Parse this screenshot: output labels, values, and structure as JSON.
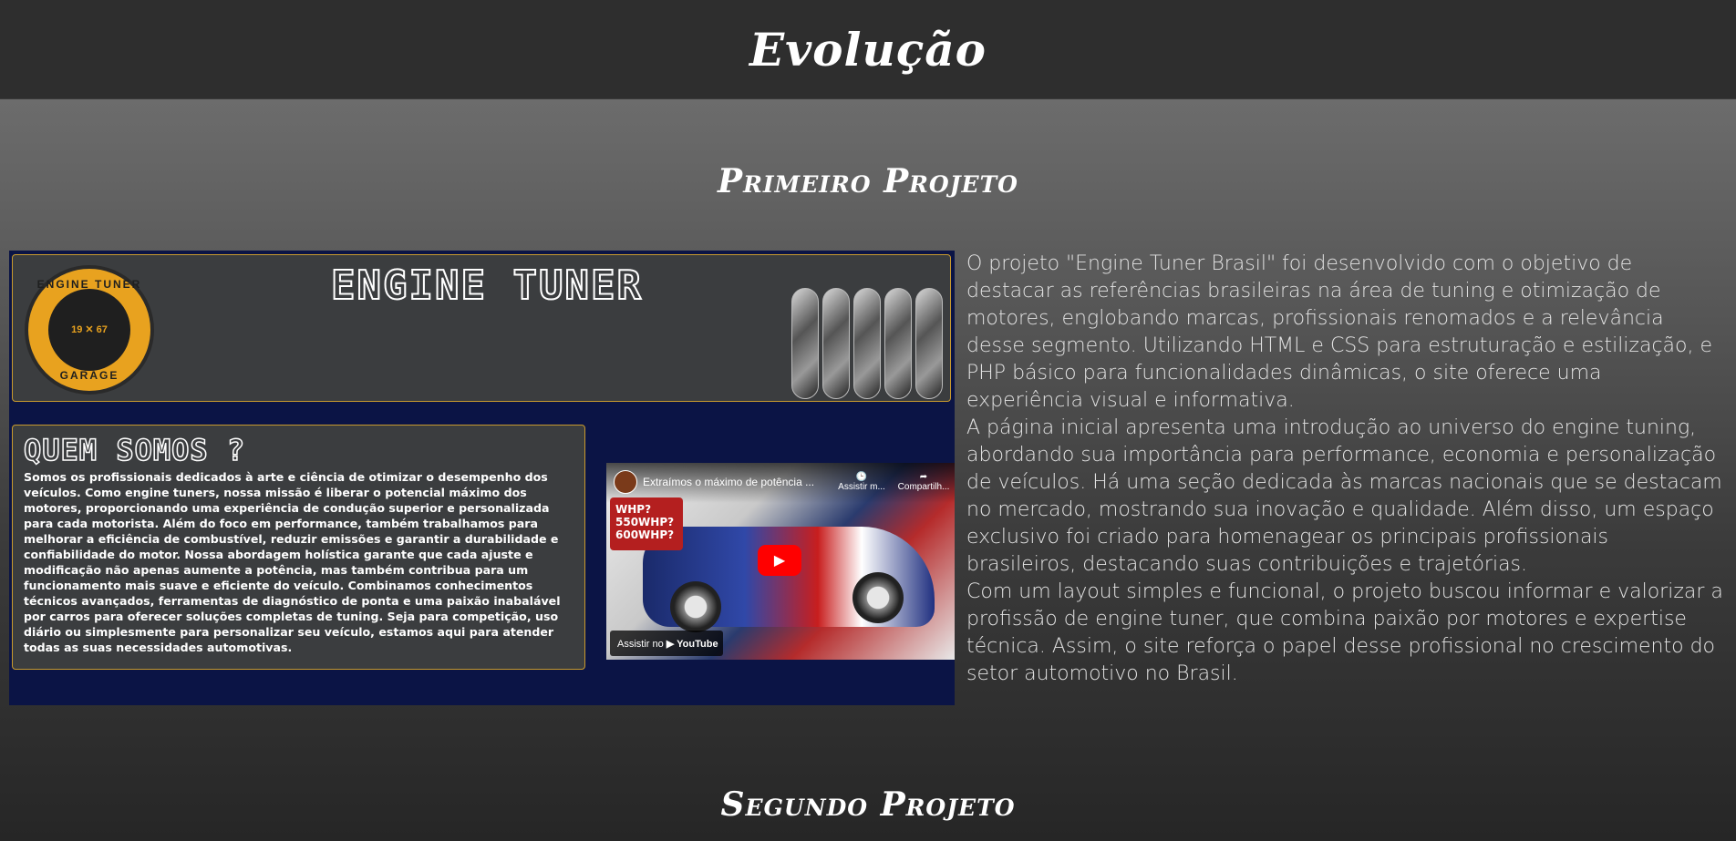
{
  "header": {
    "title": "Evolução"
  },
  "sections": [
    {
      "title": "Primeiro Projeto"
    },
    {
      "title": "Segundo Projeto"
    }
  ],
  "preview": {
    "logo": {
      "top_text": "ENGINE TUNER",
      "year_left": "19",
      "year_right": "67",
      "bottom_text": "GARAGE"
    },
    "site_title": "ENGINE TUNER",
    "about": {
      "heading": "QUEM SOMOS ?",
      "text": "Somos os profissionais dedicados à arte e ciência de otimizar o desempenho dos veículos. Como engine tuners, nossa missão é liberar o potencial máximo dos motores, proporcionando uma experiência de condução superior e personalizada para cada motorista. Além do foco em performance, também trabalhamos para melhorar a eficiência de combustível, reduzir emissões e garantir a durabilidade e confiabilidade do motor. Nossa abordagem holística garante que cada ajuste e modificação não apenas aumente a potência, mas também contribua para um funcionamento mais suave e eficiente do veículo. Combinamos conhecimentos técnicos avançados, ferramentas de diagnóstico de ponta e uma paixão inabalável por carros para oferecer soluções completas de tuning. Seja para competição, uso diário ou simplesmente para personalizar seu veículo, estamos aqui para atender todas as suas necessidades automotivas."
    },
    "video": {
      "title": "Extraímos o máximo de potência ...",
      "watch_later": "Assistir m...",
      "share": "Compartilh...",
      "badge": "WHP?\n550WHP?\n600WHP?",
      "watch_on": "Assistir no",
      "brand": "YouTube"
    }
  },
  "description": [
    "O projeto \"Engine Tuner Brasil\" foi desenvolvido com o objetivo de destacar as referências brasileiras na área de tuning e otimização de motores, englobando marcas, profissionais renomados e a relevância desse segmento. Utilizando HTML e CSS para estruturação e estilização, e PHP básico para funcionalidades dinâmicas, o site oferece uma experiência visual e informativa.",
    "A página inicial apresenta uma introdução ao universo do engine tuning, abordando sua importância para performance, economia e personalização de veículos. Há uma seção dedicada às marcas nacionais que se destacam no mercado, mostrando sua inovação e qualidade. Além disso, um espaço exclusivo foi criado para homenagear os principais profissionais brasileiros, destacando suas contribuições e trajetórias.",
    "Com um layout simples e funcional, o projeto buscou informar e valorizar a profissão de engine tuner, que combina paixão por motores e expertise técnica. Assim, o site reforça o papel desse profissional no crescimento do setor automotivo no Brasil."
  ],
  "colors": {
    "accent_gold": "#c89a2d",
    "preview_bg": "#0b1445",
    "panel": "#3b3d3f",
    "youtube_red": "#ff0000"
  }
}
